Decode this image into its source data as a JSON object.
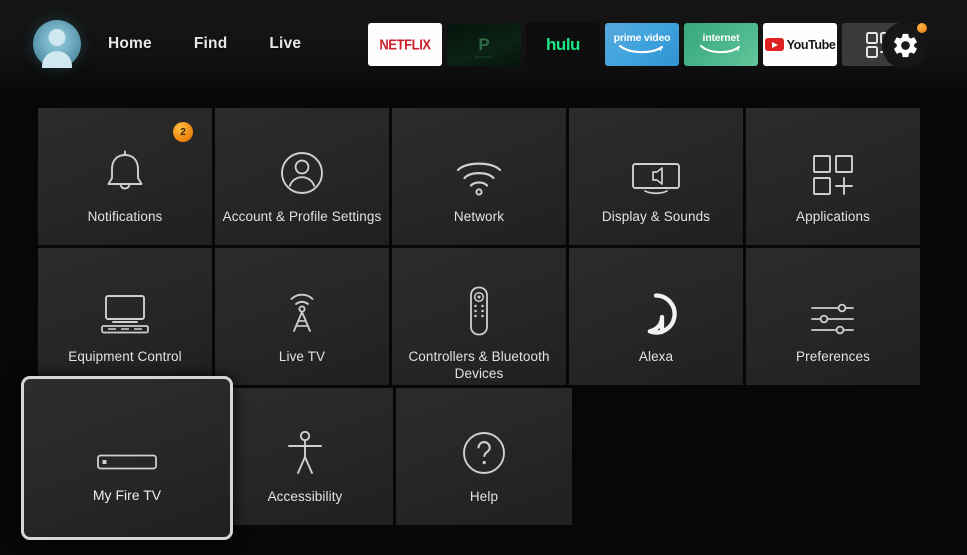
{
  "header": {
    "avatar_name": "profile-avatar",
    "nav": [
      {
        "label": "Home"
      },
      {
        "label": "Find"
      },
      {
        "label": "Live"
      }
    ],
    "apps": [
      {
        "id": "netflix",
        "label": "NETFLIX"
      },
      {
        "id": "peacock",
        "label": "P",
        "sublabel": "peacock"
      },
      {
        "id": "hulu",
        "label": "hulu"
      },
      {
        "id": "prime",
        "label": "prime video"
      },
      {
        "id": "internet",
        "label": "internet"
      },
      {
        "id": "youtube",
        "label": "YouTube"
      },
      {
        "id": "apps-grid",
        "label": ""
      }
    ],
    "settings_button": {
      "icon": "gear-icon",
      "badge": true
    }
  },
  "grid": {
    "rows": [
      [
        {
          "label": "Notifications",
          "icon": "bell-icon",
          "badge": "2"
        },
        {
          "label": "Account & Profile Settings",
          "icon": "person-circle-icon"
        },
        {
          "label": "Network",
          "icon": "wifi-icon"
        },
        {
          "label": "Display & Sounds",
          "icon": "display-sound-icon"
        },
        {
          "label": "Applications",
          "icon": "apps-grid-icon"
        }
      ],
      [
        {
          "label": "Equipment Control",
          "icon": "tv-soundbar-icon"
        },
        {
          "label": "Live TV",
          "icon": "broadcast-tower-icon"
        },
        {
          "label": "Controllers & Bluetooth Devices",
          "icon": "remote-icon"
        },
        {
          "label": "Alexa",
          "icon": "alexa-ring-icon"
        },
        {
          "label": "Preferences",
          "icon": "sliders-icon"
        }
      ],
      [
        {
          "label": "My Fire TV",
          "icon": "firetv-stick-icon",
          "selected": true
        },
        {
          "label": "Accessibility",
          "icon": "accessibility-icon"
        },
        {
          "label": "Help",
          "icon": "question-circle-icon"
        }
      ]
    ]
  },
  "colors": {
    "background": "#070707",
    "tile": "#272727",
    "selected_border": "#d6d6d2",
    "badge_orange": "#ef8a12",
    "netflix_red": "#c9202c",
    "hulu_green": "#1ce783",
    "prime_blue": "#3fa3dd",
    "internet_green": "#4cb68c",
    "youtube_red": "#e02020",
    "text": "#e2e2e2"
  }
}
